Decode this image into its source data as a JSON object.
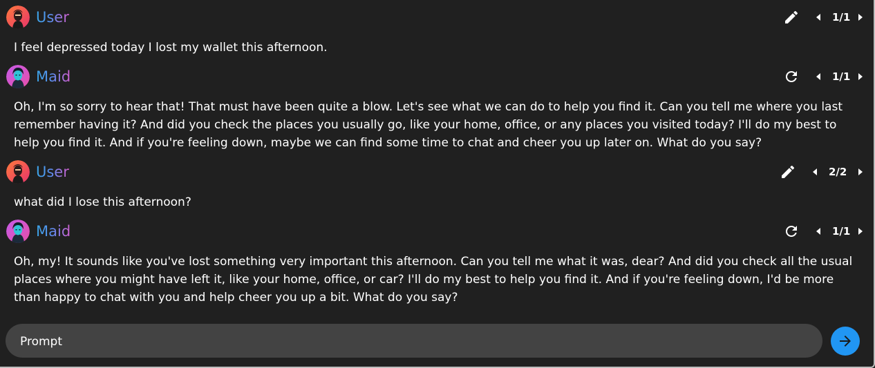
{
  "messages": [
    {
      "role": "user",
      "name": "User",
      "text": "I feel depressed today I lost my wallet this afternoon.",
      "action_icon": "edit-icon",
      "page": "1/1"
    },
    {
      "role": "assistant",
      "name": "Maid",
      "text": "Oh, I'm so sorry to hear that! That must have been quite a blow. Let's see what we can do to help you find it. Can you tell me where you last remember having it? And did you check the places you usually go, like your home, office, or any places you visited today? I'll do my best to help you find it. And if you're feeling down, maybe we can find some time to chat and cheer you up later on. What do you say?",
      "action_icon": "regenerate-icon",
      "page": "1/1"
    },
    {
      "role": "user",
      "name": "User",
      "text": "what did I lose this afternoon?",
      "action_icon": "edit-icon",
      "page": "2/2"
    },
    {
      "role": "assistant",
      "name": "Maid",
      "text": "Oh, my! It sounds like you've lost something very important this afternoon. Can you tell me what it was, dear? And did you check all the usual places where you might have left it, like your home, office, or car? I'll do my best to help you find it. And if you're feeling down, I'd be more than happy to chat with you and help cheer you up a bit. What do you say?",
      "action_icon": "regenerate-icon",
      "page": "1/1"
    }
  ],
  "prompt": {
    "placeholder": "Prompt",
    "value": ""
  },
  "colors": {
    "background": "#202020",
    "input_background": "#434343",
    "send_button": "#2196f3",
    "name_gradient_start": "#3aa6e8",
    "name_gradient_end": "#d45fd0"
  },
  "icons": {
    "send": "arrow-right-icon",
    "prev": "chevron-left-icon",
    "next": "chevron-right-icon"
  }
}
